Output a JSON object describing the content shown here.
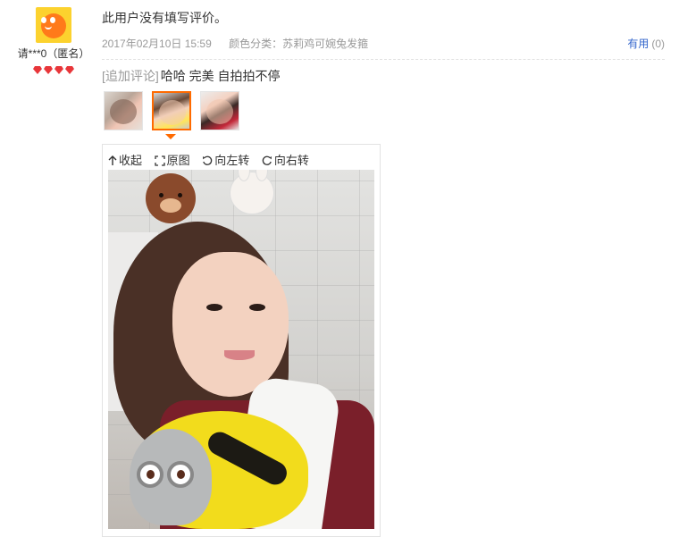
{
  "user": {
    "name": "请***0（匿名）",
    "avatar_icon": "tmall-mascot-avatar",
    "level_icon": "red-diamond-icon",
    "level_count": 4,
    "level_color": "#e8363a"
  },
  "review": {
    "text": "此用户没有填写评价。",
    "date": "2017年02月10日 15:59",
    "color_label": "颜色分类：苏莉鸡可婉兔发箍",
    "helpful_label": "有用",
    "helpful_count": "(0)",
    "append_tag": "[追加评论]",
    "append_text": "哈哈 完美 自拍拍不停"
  },
  "thumbnails": [
    {
      "name": "thumb-1",
      "selected": false
    },
    {
      "name": "thumb-2",
      "selected": true
    },
    {
      "name": "thumb-3",
      "selected": false
    }
  ],
  "viewer": {
    "collapse_label": "收起",
    "original_label": "原图",
    "rotate_left_label": "向左转",
    "rotate_right_label": "向右转"
  },
  "colors": {
    "accent": "#ff6a00",
    "link": "#3366cc",
    "muted": "#999999"
  }
}
